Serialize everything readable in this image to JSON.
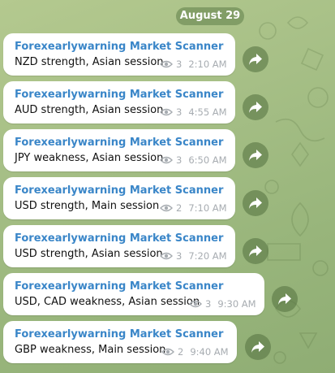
{
  "date_label": "August 29",
  "messages": [
    {
      "sender": "Forexearlywarning Market Scanner",
      "text": "NZD strength, Asian session",
      "views": "3",
      "time": "2:10 AM"
    },
    {
      "sender": "Forexearlywarning Market Scanner",
      "text": "AUD strength, Asian session",
      "views": "3",
      "time": "4:55 AM"
    },
    {
      "sender": "Forexearlywarning Market Scanner",
      "text": "JPY weakness, Asian session",
      "views": "3",
      "time": "6:50 AM"
    },
    {
      "sender": "Forexearlywarning Market Scanner",
      "text": "USD strength, Main session",
      "views": "2",
      "time": "7:10 AM"
    },
    {
      "sender": "Forexearlywarning Market Scanner",
      "text": "USD strength, Asian session",
      "views": "3",
      "time": "7:20 AM"
    },
    {
      "sender": "Forexearlywarning Market Scanner",
      "text": "USD, CAD weakness, Asian session",
      "views": "3",
      "time": "9:30 AM"
    },
    {
      "sender": "Forexearlywarning Market Scanner",
      "text": "GBP weakness, Main session",
      "views": "2",
      "time": "9:40 AM"
    }
  ],
  "icons": {
    "views": "eye-icon",
    "share": "share-icon"
  },
  "colors": {
    "sender": "#3a86c8",
    "bubble": "#ffffff",
    "meta": "#a7acb1",
    "background": "#a6bf86"
  }
}
